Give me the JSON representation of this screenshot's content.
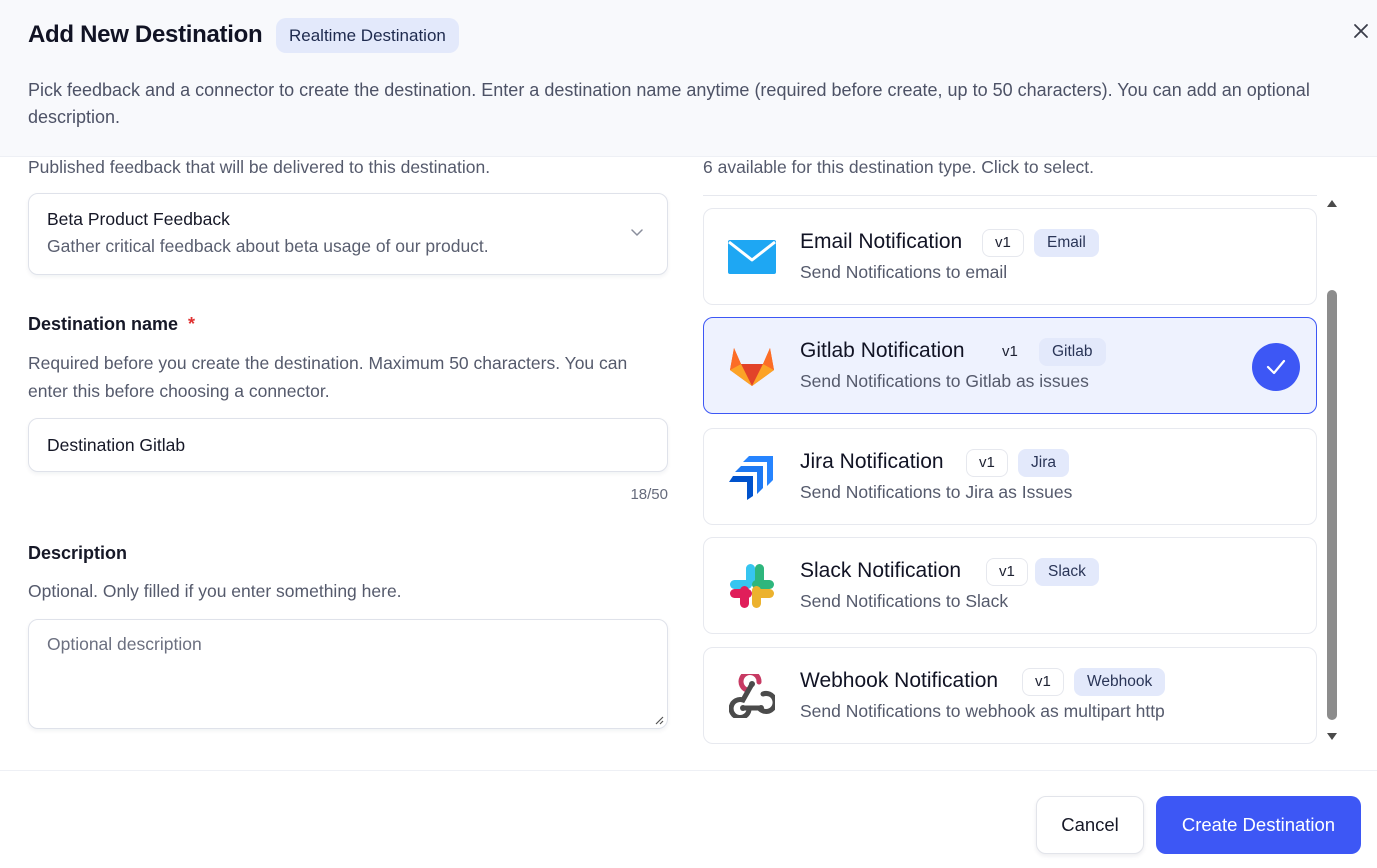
{
  "dialog": {
    "title": "Add New Destination",
    "type_badge": "Realtime Destination",
    "subtitle": "Pick feedback and a connector to create the destination. Enter a destination name anytime (required before create, up to 50 characters). You can add an optional description."
  },
  "feedback": {
    "helper": "Published feedback that will be delivered to this destination.",
    "selected_name": "Beta Product Feedback",
    "selected_description": "Gather critical feedback about beta usage of our product."
  },
  "destination_name": {
    "label": "Destination name",
    "required_mark": "*",
    "helper": "Required before you create the destination. Maximum 50 characters. You can enter this before choosing a connector.",
    "value": "Destination Gitlab",
    "counter": "18/50"
  },
  "description": {
    "label": "Description",
    "helper": "Optional. Only filled if you enter something here.",
    "placeholder": "Optional description",
    "value": ""
  },
  "connectors": {
    "helper": "6 available for this destination type. Click to select.",
    "items": [
      {
        "name": "Email Notification",
        "version": "v1",
        "tag": "Email",
        "description": "Send Notifications to email",
        "icon": "email-icon",
        "selected": false
      },
      {
        "name": "Gitlab Notification",
        "version": "v1",
        "tag": "Gitlab",
        "description": "Send Notifications to Gitlab as issues",
        "icon": "gitlab-icon",
        "selected": true
      },
      {
        "name": "Jira Notification",
        "version": "v1",
        "tag": "Jira",
        "description": "Send Notifications to Jira as Issues",
        "icon": "jira-icon",
        "selected": false
      },
      {
        "name": "Slack Notification",
        "version": "v1",
        "tag": "Slack",
        "description": "Send Notifications to Slack",
        "icon": "slack-icon",
        "selected": false
      },
      {
        "name": "Webhook Notification",
        "version": "v1",
        "tag": "Webhook",
        "description": "Send Notifications to webhook as multipart http",
        "icon": "webhook-icon",
        "selected": false
      }
    ]
  },
  "footer": {
    "cancel_label": "Cancel",
    "create_label": "Create Destination"
  },
  "colors": {
    "accent": "#3d57f5",
    "badge_bg": "#e3e9fb",
    "selected_card_bg": "#eef2fe",
    "required": "#e03131"
  }
}
